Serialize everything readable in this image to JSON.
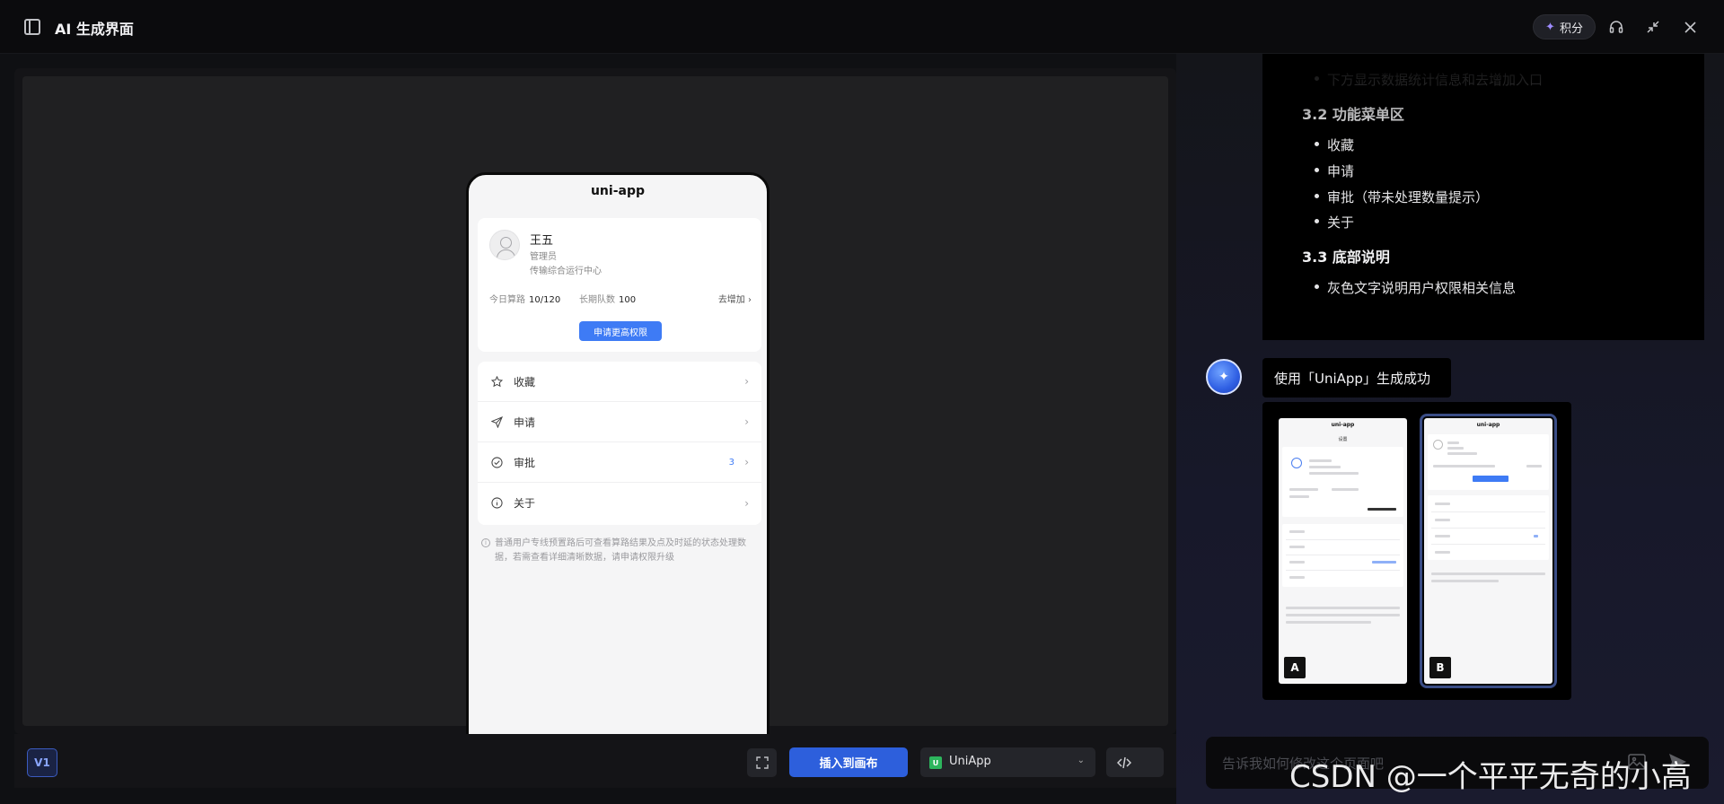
{
  "window": {
    "title": "AI 生成界面",
    "points_label": "积分"
  },
  "preview": {
    "phone": {
      "title": "uni-app",
      "profile": {
        "name": "王五",
        "role": "管理员",
        "department": "传输综合运行中心",
        "stat_today_label": "今日算路",
        "stat_today_value": "10/120",
        "stat_long_label": "长期队数",
        "stat_long_value": "100",
        "goto_add": "去增加",
        "apply_button": "申请更高权限"
      },
      "menu": [
        {
          "label": "收藏",
          "icon": "star-icon",
          "badge": ""
        },
        {
          "label": "申请",
          "icon": "send-icon",
          "badge": ""
        },
        {
          "label": "审批",
          "icon": "check-circle-icon",
          "badge": "3"
        },
        {
          "label": "关于",
          "icon": "info-icon",
          "badge": ""
        }
      ],
      "footnote": "普通用户专线预置路后可查看算路结果及点及时延的状态处理数据，若需查看详细清晰数据，请申请权限升级"
    },
    "toolbar": {
      "version": "V1",
      "insert_label": "插入到画布",
      "framework": "UniApp",
      "framework_logo": "U"
    }
  },
  "chat": {
    "doc": {
      "faded_item": "下方显示数据统计信息和去增加入口",
      "section_32": "3.2 功能菜单区",
      "items_32": [
        "收藏",
        "申请",
        "审批（带未处理数量提示）",
        "关于"
      ],
      "section_33": "3.3 底部说明",
      "items_33": [
        "灰色文字说明用户权限相关信息"
      ]
    },
    "success_message": "使用「UniApp」生成成功",
    "variants": [
      {
        "label": "A",
        "title": "uni-app",
        "header": "设置",
        "selected": false
      },
      {
        "label": "B",
        "title": "uni-app",
        "header": "",
        "selected": true
      }
    ],
    "input_placeholder": "告诉我如何修改这个页面吧",
    "watermark": "CSDN @一个平平无奇的小高"
  },
  "colors": {
    "accent": "#2d5fdc",
    "phone_button": "#3e7bf5",
    "badge": "#3e7bf5",
    "uniapp_green": "#2db55d"
  }
}
